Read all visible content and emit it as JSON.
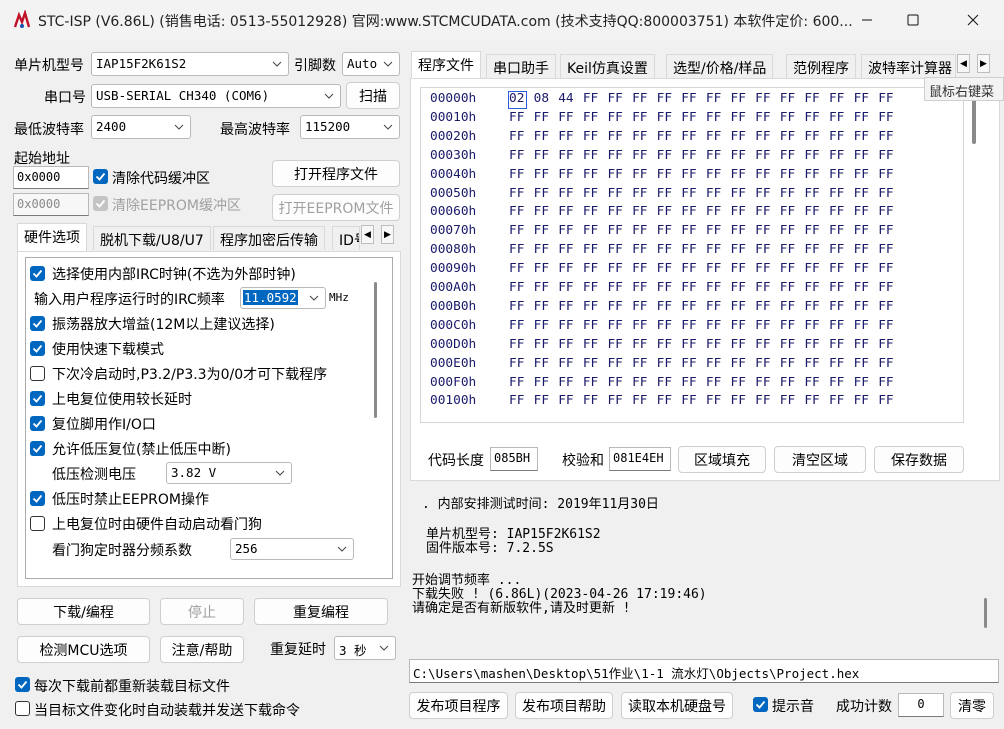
{
  "window": {
    "title": "STC-ISP (V6.86L) (销售电话: 0513-55012928) 官网:www.STCMCUDATA.com (技术支持QQ:800003751) 本软件定价: 600..."
  },
  "left": {
    "mcu_label": "单片机型号",
    "mcu_value": "IAP15F2K61S2",
    "pins_label": "引脚数",
    "pins_value": "Auto",
    "port_label": "串口号",
    "port_value": "USB-SERIAL CH340 (COM6)",
    "scan_button": "扫描",
    "min_baud_label": "最低波特率",
    "min_baud_value": "2400",
    "max_baud_label": "最高波特率",
    "max_baud_value": "115200",
    "start_addr_label": "起始地址",
    "code_addr": "0x0000",
    "clear_code_label": "清除代码缓冲区",
    "open_program_button": "打开程序文件",
    "eeprom_addr": "0x0000",
    "clear_eeprom_label": "清除EEPROM缓冲区",
    "open_eeprom_button": "打开EEPROM文件"
  },
  "hw_tabs": [
    "硬件选项",
    "脱机下载/U8/U7",
    "程序加密后传输",
    "ID号"
  ],
  "hw_options": {
    "opt1": "选择使用内部IRC时钟(不选为外部时钟)",
    "irc_label": "输入用户程序运行时的IRC频率",
    "irc_value": "11.0592",
    "irc_unit": "MHz",
    "opt2": "振荡器放大增益(12M以上建议选择)",
    "opt3": "使用快速下载模式",
    "opt4": "下次冷启动时,P3.2/P3.3为0/0才可下载程序",
    "opt5": "上电复位使用较长延时",
    "opt6": "复位脚用作I/O口",
    "opt7": "允许低压复位(禁止低压中断)",
    "lv_label": "低压检测电压",
    "lv_value": "3.82 V",
    "opt8": "低压时禁止EEPROM操作",
    "opt9": "上电复位时由硬件自动启动看门狗",
    "wdt_label": "看门狗定时器分频系数",
    "wdt_value": "256"
  },
  "actions": {
    "download": "下载/编程",
    "stop": "停止",
    "reprogram": "重复编程",
    "detect": "检测MCU选项",
    "help": "注意/帮助",
    "delay_label": "重复延时",
    "delay_value": "3 秒",
    "reload_label": "每次下载前都重新装载目标文件",
    "auto_label": "当目标文件变化时自动装载并发送下载命令"
  },
  "right_tabs": [
    "程序文件",
    "串口助手",
    "Keil仿真设置",
    "选型/价格/样品",
    "范例程序",
    "波特率计算器"
  ],
  "tooltip": "鼠标右键菜",
  "hex": {
    "rows": [
      {
        "addr": "00000h",
        "bytes": "02 08 44 FF FF FF FF FF FF FF FF FF FF FF FF FF"
      },
      {
        "addr": "00010h",
        "bytes": "FF FF FF FF FF FF FF FF FF FF FF FF FF FF FF FF"
      },
      {
        "addr": "00020h",
        "bytes": "FF FF FF FF FF FF FF FF FF FF FF FF FF FF FF FF"
      },
      {
        "addr": "00030h",
        "bytes": "FF FF FF FF FF FF FF FF FF FF FF FF FF FF FF FF"
      },
      {
        "addr": "00040h",
        "bytes": "FF FF FF FF FF FF FF FF FF FF FF FF FF FF FF FF"
      },
      {
        "addr": "00050h",
        "bytes": "FF FF FF FF FF FF FF FF FF FF FF FF FF FF FF FF"
      },
      {
        "addr": "00060h",
        "bytes": "FF FF FF FF FF FF FF FF FF FF FF FF FF FF FF FF"
      },
      {
        "addr": "00070h",
        "bytes": "FF FF FF FF FF FF FF FF FF FF FF FF FF FF FF FF"
      },
      {
        "addr": "00080h",
        "bytes": "FF FF FF FF FF FF FF FF FF FF FF FF FF FF FF FF"
      },
      {
        "addr": "00090h",
        "bytes": "FF FF FF FF FF FF FF FF FF FF FF FF FF FF FF FF"
      },
      {
        "addr": "000A0h",
        "bytes": "FF FF FF FF FF FF FF FF FF FF FF FF FF FF FF FF"
      },
      {
        "addr": "000B0h",
        "bytes": "FF FF FF FF FF FF FF FF FF FF FF FF FF FF FF FF"
      },
      {
        "addr": "000C0h",
        "bytes": "FF FF FF FF FF FF FF FF FF FF FF FF FF FF FF FF"
      },
      {
        "addr": "000D0h",
        "bytes": "FF FF FF FF FF FF FF FF FF FF FF FF FF FF FF FF"
      },
      {
        "addr": "000E0h",
        "bytes": "FF FF FF FF FF FF FF FF FF FF FF FF FF FF FF FF"
      },
      {
        "addr": "000F0h",
        "bytes": "FF FF FF FF FF FF FF FF FF FF FF FF FF FF FF FF"
      },
      {
        "addr": "00100h",
        "bytes": "FF FF FF FF FF FF FF FF FF FF FF FF FF FF FF FF"
      }
    ]
  },
  "code_info": {
    "len_label": "代码长度",
    "len_value": "085BH",
    "chk_label": "校验和",
    "chk_value": "081E4EH",
    "fill_button": "区域填充",
    "clear_button": "清空区域",
    "save_button": "保存数据"
  },
  "messages": [
    ". 内部安排测试时间: 2019年11月30日",
    "",
    "单片机型号: IAP15F2K61S2",
    "固件版本号: 7.2.5S",
    "",
    "开始调节频率 ...",
    "下载失败 ! (6.86L)(2023-04-26 17:19:46)",
    "请确定是否有新版软件,请及时更新 !"
  ],
  "footer": {
    "path": "C:\\Users\\mashen\\Desktop\\51作业\\1-1 流水灯\\Objects\\Project.hex",
    "publish_program": "发布项目程序",
    "publish_help": "发布项目帮助",
    "read_disk": "读取本机硬盘号",
    "sound_label": "提示音",
    "success_label": "成功计数",
    "success_value": "0",
    "clear_button": "清零"
  }
}
